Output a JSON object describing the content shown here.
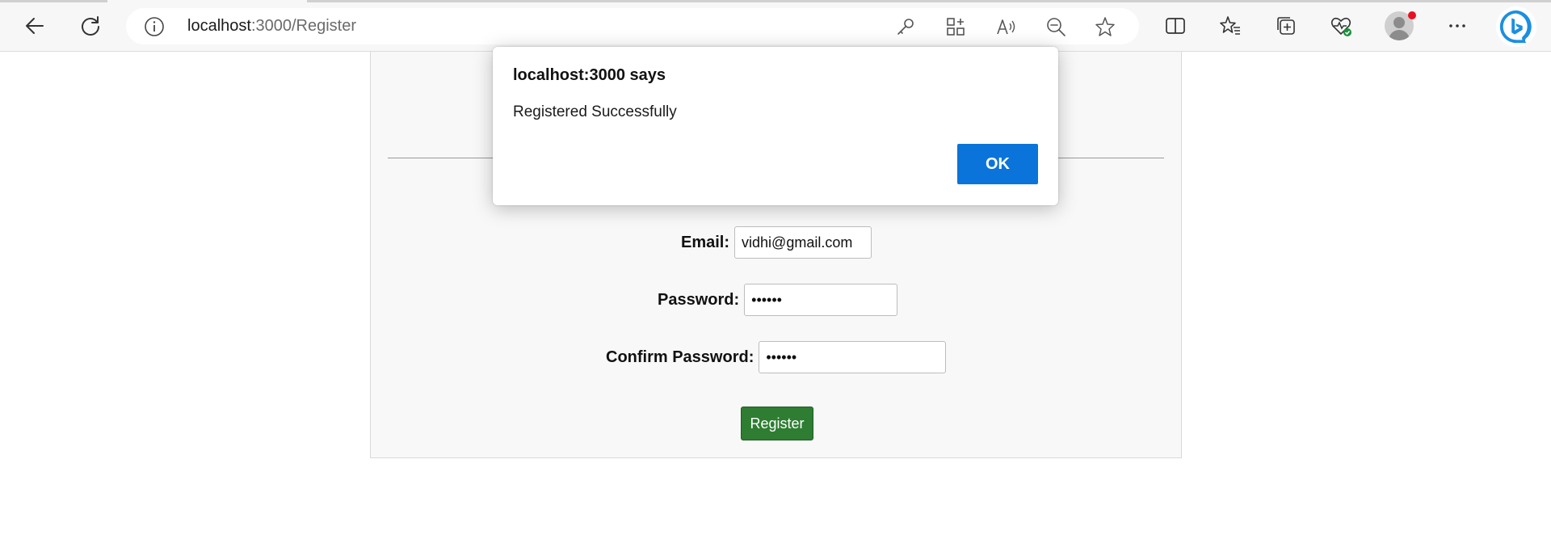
{
  "browser": {
    "url_host": "localhost",
    "url_path": ":3000/Register",
    "icons": [
      "back-icon",
      "refresh-icon",
      "site-info-icon",
      "password-key-icon",
      "apps-icon",
      "read-aloud-icon",
      "zoom-out-icon",
      "favorite-star-icon",
      "split-screen-icon",
      "favorites-icon",
      "collections-icon",
      "browser-essentials-icon",
      "profile-icon",
      "more-icon",
      "bing-chat-icon"
    ]
  },
  "form": {
    "email_label": "Email:",
    "email_value": "vidhi@gmail.com",
    "password_label": "Password:",
    "password_value": "••••••",
    "confirm_label": "Confirm Password:",
    "confirm_value": "••••••",
    "register_label": "Register"
  },
  "dialog": {
    "title": "localhost:3000 says",
    "message": "Registered Successfully",
    "ok_label": "OK"
  },
  "colors": {
    "register_button": "#2e7d32",
    "ok_button": "#0a74da"
  }
}
